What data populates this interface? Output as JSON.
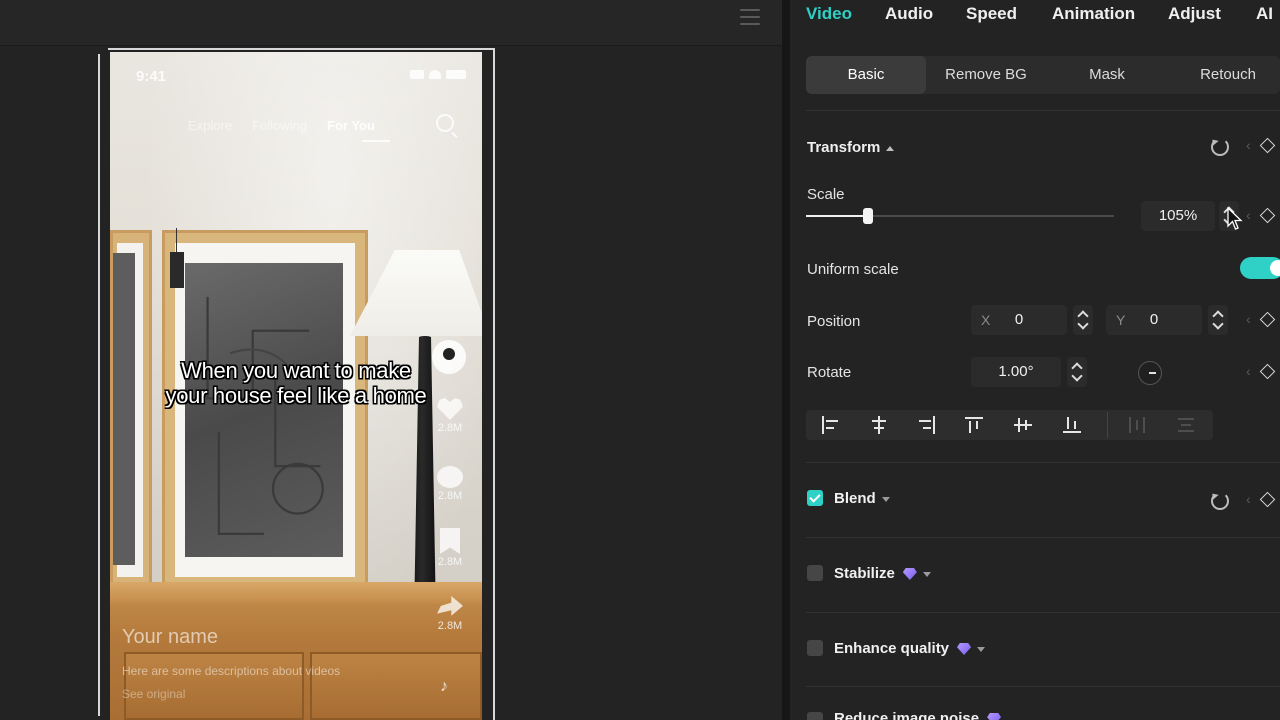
{
  "preview": {
    "phone": {
      "status_time": "9:41",
      "nav_tabs": [
        "Explore",
        "Following",
        "For You"
      ],
      "active_tab": "For You",
      "caption_line1": "When you want to make",
      "caption_line2": "your house feel like a home",
      "counts": [
        "2.8M",
        "2.8M",
        "2.8M",
        "2.8M"
      ],
      "username": "Your name",
      "description": "Here are some descriptions about videos",
      "see_original": "See original"
    }
  },
  "panel": {
    "tabs": [
      "Video",
      "Audio",
      "Speed",
      "Animation",
      "Adjust",
      "AI"
    ],
    "active_tab": "Video",
    "subtabs": [
      "Basic",
      "Remove BG",
      "Mask",
      "Retouch"
    ],
    "active_subtab": "Basic",
    "transform": {
      "title": "Transform",
      "scale_label": "Scale",
      "scale_value": "105%",
      "scale_fraction": 0.2,
      "uniform_label": "Uniform scale",
      "uniform_on": true,
      "position_label": "Position",
      "x_label": "X",
      "x_value": "0",
      "y_label": "Y",
      "y_value": "0",
      "rotate_label": "Rotate",
      "rotate_value": "1.00°"
    },
    "sections": {
      "blend": "Blend",
      "stabilize": "Stabilize",
      "enhance": "Enhance quality",
      "reduce": "Reduce image noise"
    }
  },
  "colors": {
    "accent": "#2fd1c6",
    "panel_bg": "#232323",
    "pro_gem": "#8f73f5"
  }
}
